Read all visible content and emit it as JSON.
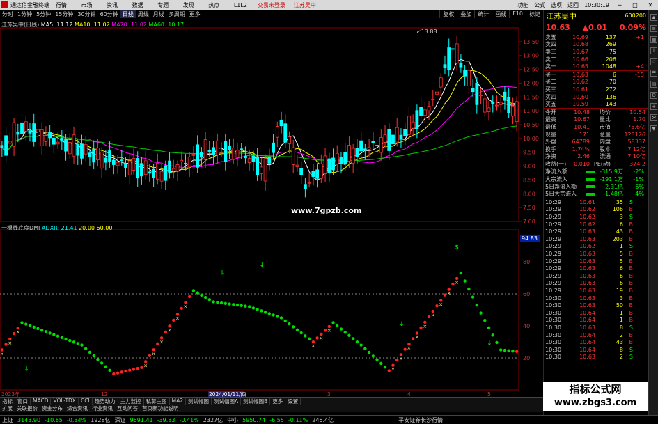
{
  "titlebar": {
    "app_name": "通达信金融终端",
    "menu": [
      "行情",
      "市场",
      "资讯",
      "数据",
      "专题",
      "发现",
      "热点",
      "L1L2"
    ],
    "login": "交易未登录",
    "stock": "江苏吴中",
    "right": [
      "功能",
      "公式",
      "选项",
      "返回"
    ],
    "time": "10:30:19"
  },
  "toolbar": {
    "periods": [
      "分时",
      "1分钟",
      "5分钟",
      "15分钟",
      "30分钟",
      "60分钟",
      "日线",
      "周线",
      "月线",
      "多周期",
      "更多"
    ],
    "active_period": "日线",
    "right": [
      "复权",
      "叠加",
      "统计",
      "画线",
      "F10",
      "标记"
    ]
  },
  "chart_header": {
    "name_line": "江苏吴中(日线)",
    "ma5": "MA5: 11.12",
    "ma10": "MA10: 11.02",
    "ma20": "MA20: 11.02",
    "ma60": "MA60: 10.17",
    "peak_label": "13.88",
    "y_ticks": [
      "13.50",
      "13.00",
      "12.50",
      "12.00",
      "11.50",
      "11.00",
      "10.50",
      "10.00",
      "9.50",
      "9.00",
      "8.50",
      "8.00",
      "7.50",
      "7.00"
    ]
  },
  "sub_header": {
    "name": "一根线底度DMI",
    "adx": "ADXR: 21.41",
    "l1": "20.00",
    "l2": "60.00",
    "tag_94": "94.83",
    "y_ticks": [
      "80",
      "60",
      "40",
      "20"
    ]
  },
  "x_labels": [
    "2023年",
    "12",
    "2024/01/11/四",
    "3",
    "4",
    "5"
  ],
  "site_mark": "www.7gpzb.com",
  "panel": {
    "name": "江苏吴中",
    "code": "600200",
    "price": "10.63",
    "change": "▲0.01",
    "pct": "0.09%",
    "asks": [
      {
        "lab": "卖五",
        "pr": "10.69",
        "vol": "137",
        "chg": "+1"
      },
      {
        "lab": "卖四",
        "pr": "10.68",
        "vol": "269",
        "chg": ""
      },
      {
        "lab": "卖三",
        "pr": "10.67",
        "vol": "75",
        "chg": ""
      },
      {
        "lab": "卖二",
        "pr": "10.66",
        "vol": "206",
        "chg": ""
      },
      {
        "lab": "卖一",
        "pr": "10.65",
        "vol": "1048",
        "chg": "+4"
      }
    ],
    "bids": [
      {
        "lab": "买一",
        "pr": "10.63",
        "vol": "6",
        "chg": "-15"
      },
      {
        "lab": "买二",
        "pr": "10.62",
        "vol": "70",
        "chg": ""
      },
      {
        "lab": "买三",
        "pr": "10.61",
        "vol": "272",
        "chg": ""
      },
      {
        "lab": "买四",
        "pr": "10.60",
        "vol": "136",
        "chg": ""
      },
      {
        "lab": "买五",
        "pr": "10.59",
        "vol": "143",
        "chg": ""
      }
    ],
    "stats": [
      {
        "k1": "今开",
        "v1": "10.48",
        "k2": "均价",
        "v2": "10.54"
      },
      {
        "k1": "最高",
        "v1": "10.67",
        "k2": "量比",
        "v2": "1.70"
      },
      {
        "k1": "最低",
        "v1": "10.41",
        "k2": "市值",
        "v2": "75.6亿"
      },
      {
        "k1": "现量",
        "v1": "171",
        "k2": "总量",
        "v2": "123126"
      },
      {
        "k1": "外盘",
        "v1": "64789",
        "k2": "内盘",
        "v2": "58337"
      },
      {
        "k1": "换手",
        "v1": "1.74%",
        "k2": "股本",
        "v2": "7.12亿"
      },
      {
        "k1": "净资",
        "v1": "2.46",
        "k2": "流通",
        "v2": "7.10亿"
      },
      {
        "k1": "收益(一)",
        "v1": "0.010",
        "k2": "PE(动)",
        "v2": "374.2"
      }
    ],
    "flows": [
      {
        "k": "净流入额",
        "v": "-315.9万",
        "p": "-2%"
      },
      {
        "k": "大宗流入",
        "v": "-191.1万",
        "p": "-1%"
      },
      {
        "k": "5日净流入额",
        "v": "-2.31亿",
        "p": "-6%"
      },
      {
        "k": "5日大宗流入",
        "v": "-1.48亿",
        "p": "-4%"
      }
    ],
    "ticks": [
      {
        "t": "10:29",
        "p": "10.61",
        "v": "35",
        "s": "S"
      },
      {
        "t": "10:29",
        "p": "10.62",
        "v": "106",
        "s": "B"
      },
      {
        "t": "10:29",
        "p": "10.62",
        "v": "3",
        "s": "S"
      },
      {
        "t": "10:29",
        "p": "10.62",
        "v": "6",
        "s": "B"
      },
      {
        "t": "10:29",
        "p": "10.63",
        "v": "43",
        "s": "B"
      },
      {
        "t": "10:29",
        "p": "10.63",
        "v": "203",
        "s": "B"
      },
      {
        "t": "10:29",
        "p": "10.62",
        "v": "1",
        "s": "S"
      },
      {
        "t": "10:29",
        "p": "10.63",
        "v": "5",
        "s": "B"
      },
      {
        "t": "10:29",
        "p": "10.63",
        "v": "5",
        "s": "B"
      },
      {
        "t": "10:29",
        "p": "10.63",
        "v": "6",
        "s": "B"
      },
      {
        "t": "10:29",
        "p": "10.63",
        "v": "6",
        "s": "B"
      },
      {
        "t": "10:29",
        "p": "10.63",
        "v": "6",
        "s": "B"
      },
      {
        "t": "10:29",
        "p": "10.63",
        "v": "19",
        "s": "B"
      },
      {
        "t": "10:30",
        "p": "10.63",
        "v": "3",
        "s": "B"
      },
      {
        "t": "10:30",
        "p": "10.63",
        "v": "50",
        "s": "B"
      },
      {
        "t": "10:30",
        "p": "10.64",
        "v": "1",
        "s": "B"
      },
      {
        "t": "10:30",
        "p": "10.64",
        "v": "1",
        "s": "B"
      },
      {
        "t": "10:30",
        "p": "10.63",
        "v": "8",
        "s": "S"
      },
      {
        "t": "10:30",
        "p": "10.64",
        "v": "2",
        "s": "B"
      },
      {
        "t": "10:30",
        "p": "10.64",
        "v": "43",
        "s": "B"
      },
      {
        "t": "10:30",
        "p": "10.64",
        "v": "8",
        "s": "S"
      },
      {
        "t": "10:30",
        "p": "10.63",
        "v": "2",
        "s": "S"
      }
    ]
  },
  "bottom_tabs": [
    "指标",
    "窗口",
    "MACD",
    "VOL-TDX",
    "CCI",
    "趋势动力",
    "主力监控",
    "私募主图",
    "MA2",
    "测试幅图",
    "测试幅图A",
    "测试幅图B",
    "更多",
    "设置"
  ],
  "bottom_tabs2": [
    "扩展",
    "关联报价",
    "资金分布",
    "综合资讯",
    "行业资讯",
    "互动问答",
    "首页新功能说明"
  ],
  "status": {
    "sh_label": "上证",
    "sh": "3143.90",
    "sh_chg": "-10.65",
    "sh_pct": "-0.34%",
    "sh_amt": "1928亿",
    "sz_label": "深证",
    "sz": "9691.41",
    "sz_chg": "-39.83",
    "sz_pct": "-0.41%",
    "sz_amt": "2327亿",
    "zx_label": "中小",
    "zx": "5950.74",
    "zx_chg": "-6.55",
    "zx_pct": "-0.11%",
    "zx_amt": "246.4亿",
    "broker": "平安证券长沙行情"
  },
  "watermark": {
    "line1": "指标公式网",
    "line2": "www.zbgs3.com"
  },
  "chart_data": {
    "type": "candlestick",
    "title": "江苏吴中(日线)",
    "ylim": [
      7.0,
      14.0
    ],
    "sub_ylim": [
      0,
      100
    ],
    "ma": {
      "MA5": 11.12,
      "MA10": 11.02,
      "MA20": 11.02,
      "MA60": 10.17
    }
  },
  "colors": {
    "up": "#ff3333",
    "down": "#00ffff",
    "ma5": "#ffffff",
    "ma10": "#ffff00",
    "ma20": "#ff00ff",
    "ma60": "#00cc00",
    "dot_up": "#ff2020",
    "dot_dn": "#00dd00",
    "dot_star": "#ffee88"
  }
}
